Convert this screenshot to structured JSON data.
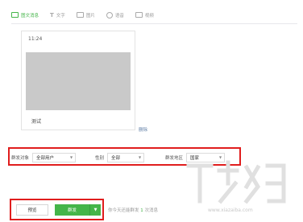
{
  "tabs": [
    {
      "label": "图文消息",
      "active": true
    },
    {
      "label": "文字",
      "active": false
    },
    {
      "label": "图片",
      "active": false
    },
    {
      "label": "语音",
      "active": false
    },
    {
      "label": "视频",
      "active": false
    }
  ],
  "card": {
    "time": "11:24",
    "caption": "测试",
    "delete_label": "删除"
  },
  "filters": {
    "target_label": "群发对象",
    "target_value": "全部用户",
    "gender_label": "性别",
    "gender_value": "全部",
    "region_label": "群发地区",
    "region_value": "国家"
  },
  "actions": {
    "preview_label": "预览",
    "send_label": "群发"
  },
  "hint": {
    "prefix": "你今天还能群发",
    "count": "1",
    "suffix": "次消息"
  },
  "watermark": {
    "url": "www.xiazaiba.com"
  },
  "colors": {
    "accent": "#44b549",
    "highlight": "#e01d1d",
    "link": "#607fa6"
  }
}
